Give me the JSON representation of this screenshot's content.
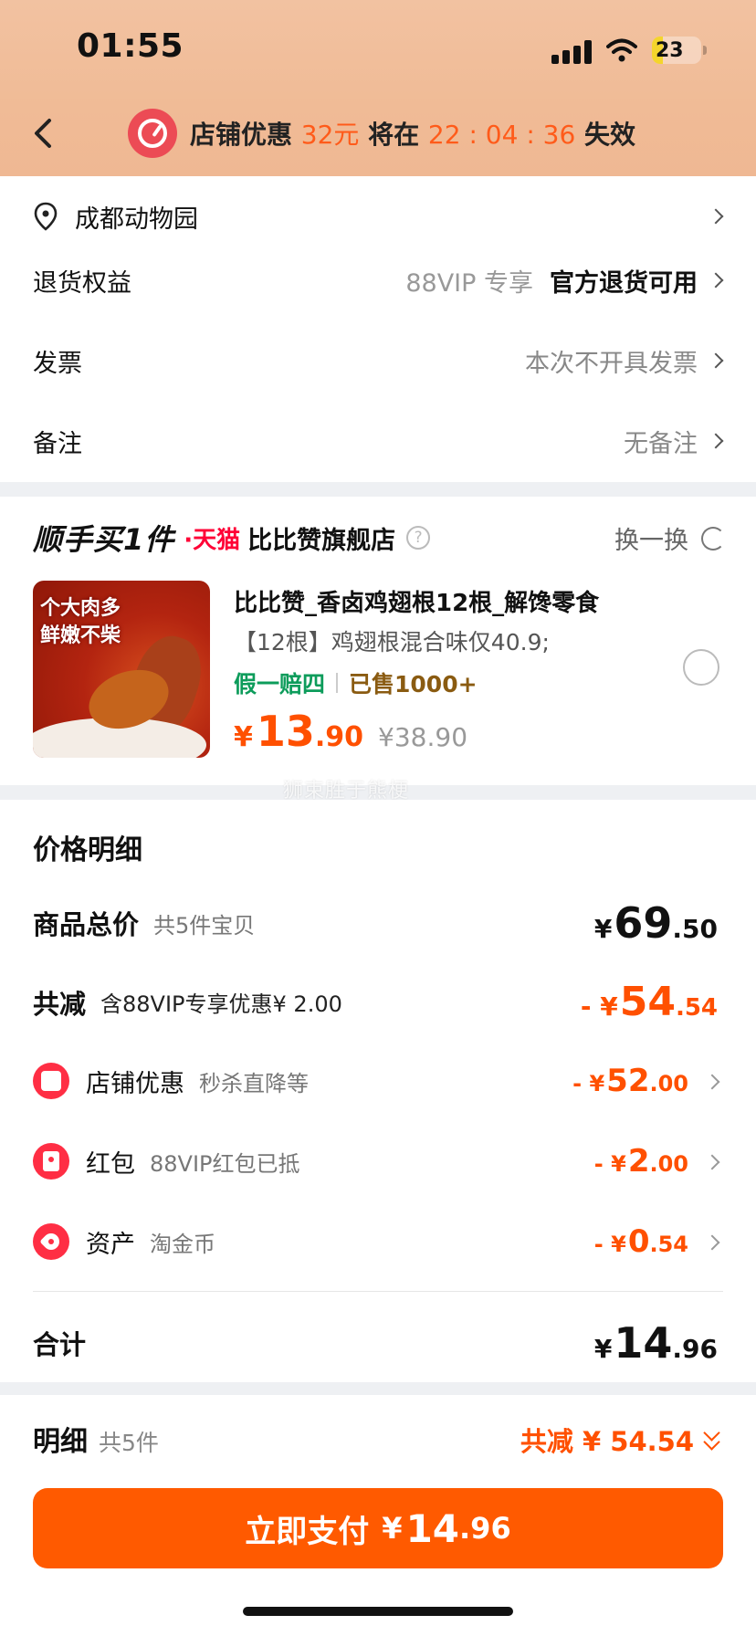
{
  "status_bar": {
    "time": "01:55",
    "battery": "23",
    "battery_level": 0.23
  },
  "header": {
    "promo_prefix": "店铺优惠",
    "promo_amount": "32元",
    "promo_mid": "将在",
    "promo_countdown": "22 : 04 : 36",
    "promo_suffix": "失效"
  },
  "order_info": {
    "address": "成都动物园",
    "return_label": "退货权益",
    "return_tag": "88VIP 专享",
    "return_value": "官方退货可用",
    "invoice_label": "发票",
    "invoice_value": "本次不开具发票",
    "note_label": "备注",
    "note_value": "无备注"
  },
  "store": {
    "promo_brand": "顺手买1件",
    "platform": "·天猫",
    "name": "比比赞旗舰店",
    "help": "?",
    "swap_label": "换一换"
  },
  "product": {
    "image_text_line1": "个大肉多",
    "image_text_line2": "鲜嫩不柴",
    "title": "比比赞_香卤鸡翅根12根_解馋零食",
    "desc": "【12根】鸡翅根混合味仅40.9;",
    "guarantee": "假一赔四",
    "sold": "已售1000+",
    "price_currency": "¥",
    "price_int": "13",
    "price_dec": ".90",
    "original_price": "¥38.90"
  },
  "watermark": "狮束胜于熊梗",
  "price_detail": {
    "title": "价格明细",
    "total_label": "商品总价",
    "total_sub": "共5件宝贝",
    "total_cur": "¥",
    "total_int": "69",
    "total_dec": ".50",
    "reduce_label": "共减",
    "reduce_sub": "含88VIP专享优惠¥ 2.00",
    "reduce_cur": "- ¥",
    "reduce_int": "54",
    "reduce_dec": ".54",
    "items": [
      {
        "label": "店铺优惠",
        "sub": "秒杀直降等",
        "cur": "- ¥",
        "int": "52",
        "dec": ".00",
        "icon": "store-icon"
      },
      {
        "label": "红包",
        "sub": "88VIP红包已抵",
        "cur": "- ¥",
        "int": "2",
        "dec": ".00",
        "icon": "red-envelope-icon"
      },
      {
        "label": "资产",
        "sub": "淘金币",
        "cur": "- ¥",
        "int": "0",
        "dec": ".54",
        "icon": "coupon-tag-icon"
      }
    ],
    "sum_label": "合计",
    "sum_cur": "¥",
    "sum_int": "14",
    "sum_dec": ".96"
  },
  "bottom": {
    "detail_label": "明细",
    "detail_count": "共5件",
    "saved": "共减 ¥ 54.54",
    "pay_label": "立即支付",
    "pay_cur": "¥",
    "pay_int": "14",
    "pay_dec": ".96"
  },
  "colors": {
    "accent": "#ff5000",
    "pay_button": "#ff5a00",
    "header_bg": "#f0bb96",
    "green": "#0d9c5b",
    "tmall_red": "#ff0036"
  }
}
